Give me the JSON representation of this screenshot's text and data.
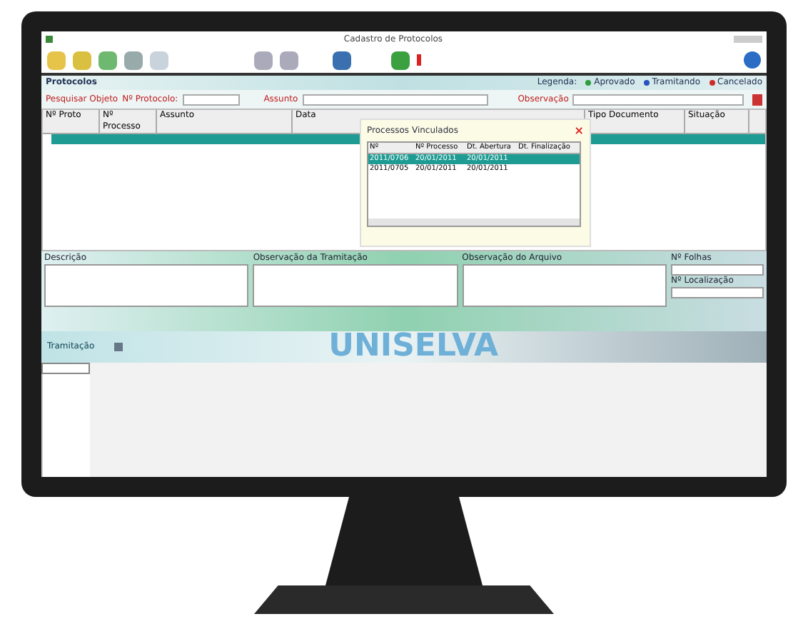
{
  "window": {
    "title": "Cadastro de Protocolos"
  },
  "section": {
    "title": "Protocolos"
  },
  "legend": {
    "label": "Legenda:",
    "items": [
      {
        "label": "Aprovado",
        "color": "#2e9e3e"
      },
      {
        "label": "Tramitando",
        "color": "#2a4fc0"
      },
      {
        "label": "Cancelado",
        "color": "#d02a2a"
      }
    ]
  },
  "filters": [
    {
      "label": "Pesquisar Objeto"
    },
    {
      "label": "Nº Protocolo:"
    },
    {
      "label": "Assunto"
    },
    {
      "label": "Observação"
    }
  ],
  "grid": {
    "columns": [
      "Nº Proto",
      "Nº Processo",
      "Assunto",
      "Data",
      "Tipo Documento",
      "Situação"
    ],
    "rows": [
      {
        "selected": true
      }
    ]
  },
  "popup": {
    "title": "Processos Vinculados",
    "close": "×",
    "columns": [
      "Nº",
      "Nº Processo",
      "Dt. Abertura",
      "Dt. Finalização"
    ],
    "rows": [
      {
        "cells": [
          "2011/0706",
          "20/01/2011",
          "20/01/2011"
        ],
        "selected": true
      },
      {
        "cells": [
          "2011/0705",
          "20/01/2011",
          "20/01/2011"
        ],
        "selected": false
      }
    ]
  },
  "details": [
    {
      "label": "Descrição"
    },
    {
      "label": "Observação da Tramitação"
    },
    {
      "label": "Observação do Arquivo"
    }
  ],
  "side_fields": [
    {
      "label": "Nº Folhas"
    },
    {
      "label": "Nº Localização"
    }
  ],
  "tramitacao": {
    "label": "Tramitação"
  },
  "logo": "UNISELVA"
}
